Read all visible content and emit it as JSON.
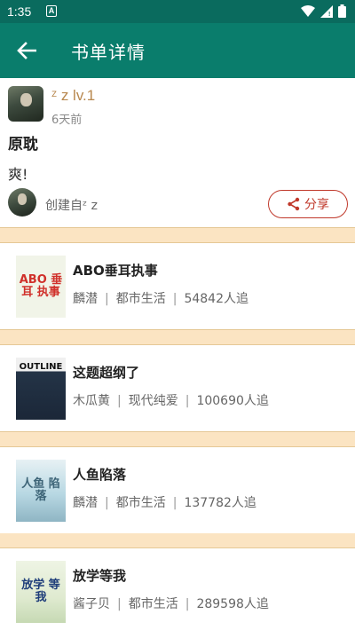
{
  "status_bar": {
    "time": "1:35",
    "notification_letter": "A"
  },
  "app_bar": {
    "title": "书单详情"
  },
  "header": {
    "username": "ᶻ z  lv.1",
    "time_ago": "6天前",
    "booklist_title": "原耽",
    "description": "爽!",
    "created_by": "创建自ᶻ z",
    "share_label": "分享"
  },
  "books": [
    {
      "title": "ABO垂耳执事",
      "author": "麟潜",
      "category": "都市生活",
      "followers": "54842人追",
      "cover_text": "ABO 垂耳 执事",
      "cover_color": "#f1f4e8",
      "cover_text_color": "#d0302a"
    },
    {
      "title": "这题超纲了",
      "author": "木瓜黄",
      "category": "现代纯爱",
      "followers": "100690人追",
      "cover_text": "OUTLINE",
      "cover_color": "#243447",
      "cover_text_color": "#ffffff"
    },
    {
      "title": "人鱼陷落",
      "author": "麟潜",
      "category": "都市生活",
      "followers": "137782人追",
      "cover_text": "人鱼 陷落",
      "cover_color": "#b8d8e3",
      "cover_text_color": "#3d6477"
    },
    {
      "title": "放学等我",
      "author": "酱子贝",
      "category": "都市生活",
      "followers": "289598人追",
      "cover_text": "放学 等我",
      "cover_color": "#dfead0",
      "cover_text_color": "#1f3e7a"
    }
  ],
  "colors": {
    "primary": "#0a7d6c",
    "status": "#0a6b5e",
    "separator": "#fbe4c2",
    "share": "#c0392b",
    "username": "#b8884f"
  }
}
